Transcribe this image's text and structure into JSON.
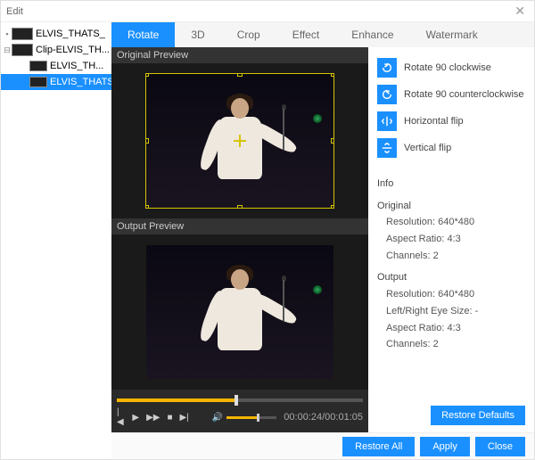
{
  "window": {
    "title": "Edit"
  },
  "tree": {
    "items": [
      {
        "label": "ELVIS_THATS_"
      },
      {
        "label": "Clip-ELVIS_TH..."
      },
      {
        "label": "ELVIS_TH..."
      },
      {
        "label": "ELVIS_THATS_"
      }
    ]
  },
  "tabs": {
    "rotate": "Rotate",
    "threeD": "3D",
    "crop": "Crop",
    "effect": "Effect",
    "enhance": "Enhance",
    "watermark": "Watermark"
  },
  "preview": {
    "original_label": "Original Preview",
    "output_label": "Output Preview"
  },
  "transport": {
    "time": "00:00:24/00:01:05"
  },
  "rotate_ops": {
    "cw": "Rotate 90 clockwise",
    "ccw": "Rotate 90 counterclockwise",
    "hflip": "Horizontal flip",
    "vflip": "Vertical flip"
  },
  "info": {
    "heading": "Info",
    "original": {
      "title": "Original",
      "resolution_label": "Resolution:",
      "resolution": "640*480",
      "aspect_label": "Aspect Ratio:",
      "aspect": "4:3",
      "channels_label": "Channels:",
      "channels": "2"
    },
    "output": {
      "title": "Output",
      "resolution_label": "Resolution:",
      "resolution": "640*480",
      "eye_label": "Left/Right Eye Size:",
      "eye": "-",
      "aspect_label": "Aspect Ratio:",
      "aspect": "4:3",
      "channels_label": "Channels:",
      "channels": "2"
    }
  },
  "buttons": {
    "restore_defaults": "Restore Defaults",
    "restore_all": "Restore All",
    "apply": "Apply",
    "close": "Close"
  }
}
